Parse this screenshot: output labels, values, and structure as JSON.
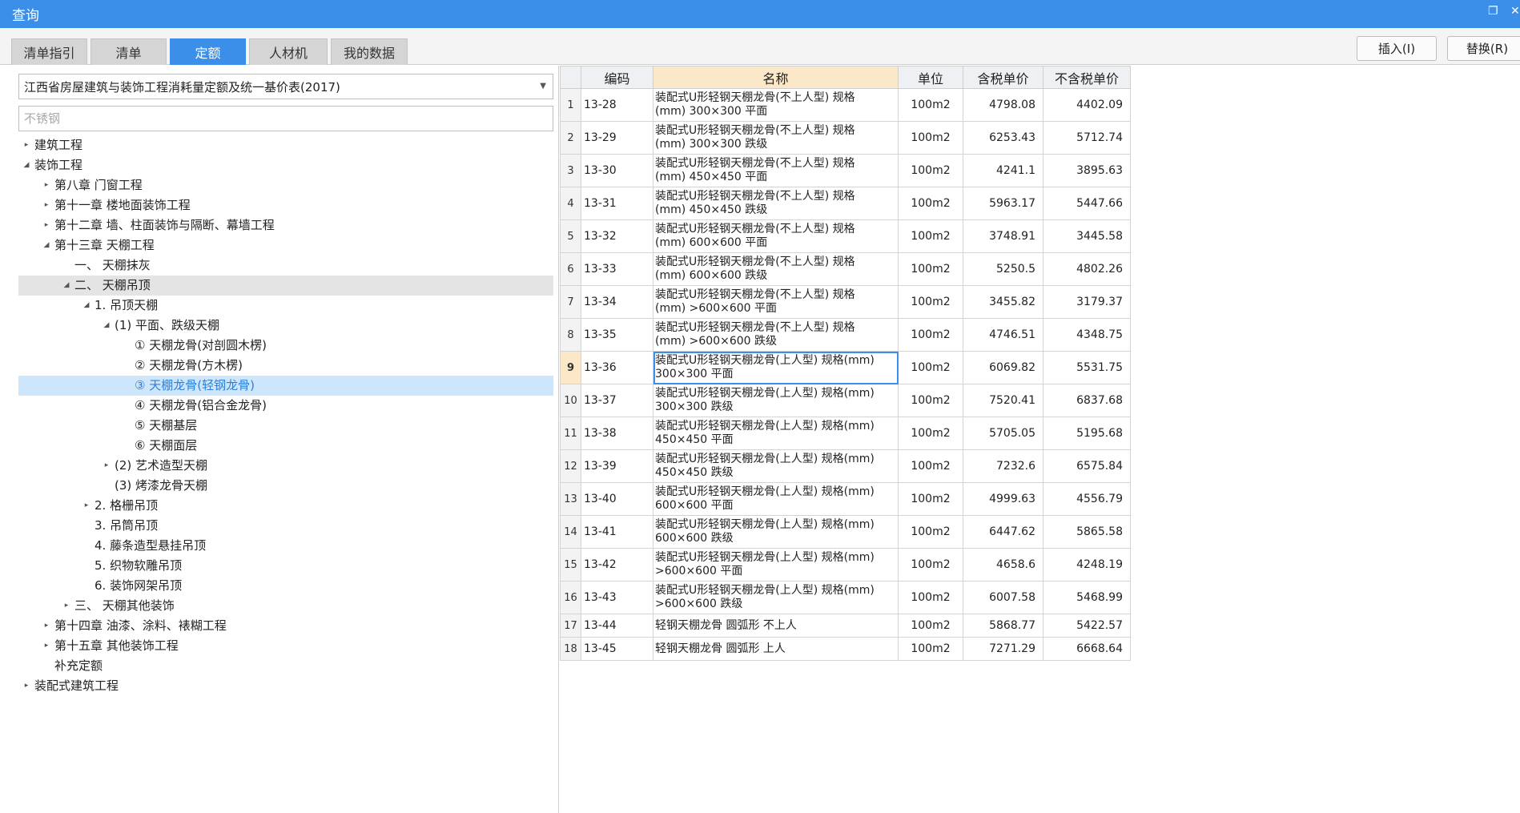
{
  "window": {
    "title": "查询",
    "restore_icon": "restore-icon",
    "close_icon": "close-icon"
  },
  "tabs": [
    {
      "label": "清单指引",
      "active": false
    },
    {
      "label": "清单",
      "active": false
    },
    {
      "label": "定额",
      "active": true
    },
    {
      "label": "人材机",
      "active": false
    },
    {
      "label": "我的数据",
      "active": false
    }
  ],
  "buttons": {
    "insert": "插入(I)",
    "replace": "替换(R)"
  },
  "library": {
    "selected": "江西省房屋建筑与装饰工程消耗量定额及统一基价表(2017)"
  },
  "search": {
    "value": "",
    "placeholder": "不锈钢"
  },
  "tree": [
    {
      "label": "建筑工程",
      "toggle": "▸"
    },
    {
      "label": "装饰工程",
      "toggle": "◢"
    },
    {
      "label": "第八章 门窗工程",
      "toggle": "▸"
    },
    {
      "label": "第十一章 楼地面装饰工程",
      "toggle": "▸"
    },
    {
      "label": "第十二章 墙、柱面装饰与隔断、幕墙工程",
      "toggle": "▸"
    },
    {
      "label": "第十三章 天棚工程",
      "toggle": "◢"
    },
    {
      "label": "一、 天棚抹灰",
      "toggle": ""
    },
    {
      "label": "二、 天棚吊顶",
      "toggle": "◢"
    },
    {
      "label": "1. 吊顶天棚",
      "toggle": "◢"
    },
    {
      "label": "(1) 平面、跌级天棚",
      "toggle": "◢"
    },
    {
      "label": "① 天棚龙骨(对剖圆木楞)",
      "toggle": ""
    },
    {
      "label": "② 天棚龙骨(方木楞)",
      "toggle": ""
    },
    {
      "label": "③ 天棚龙骨(轻钢龙骨)",
      "toggle": ""
    },
    {
      "label": "④ 天棚龙骨(铝合金龙骨)",
      "toggle": ""
    },
    {
      "label": "⑤ 天棚基层",
      "toggle": ""
    },
    {
      "label": "⑥ 天棚面层",
      "toggle": ""
    },
    {
      "label": "(2) 艺术造型天棚",
      "toggle": "▸"
    },
    {
      "label": "(3) 烤漆龙骨天棚",
      "toggle": ""
    },
    {
      "label": "2. 格栅吊顶",
      "toggle": "▸"
    },
    {
      "label": "3. 吊筒吊顶",
      "toggle": ""
    },
    {
      "label": "4. 藤条造型悬挂吊顶",
      "toggle": ""
    },
    {
      "label": "5. 织物软雕吊顶",
      "toggle": ""
    },
    {
      "label": "6. 装饰网架吊顶",
      "toggle": ""
    },
    {
      "label": "三、 天棚其他装饰",
      "toggle": "▸"
    },
    {
      "label": "第十四章 油漆、涂料、裱糊工程",
      "toggle": "▸"
    },
    {
      "label": "第十五章 其他装饰工程",
      "toggle": "▸"
    },
    {
      "label": "补充定额",
      "toggle": ""
    },
    {
      "label": "装配式建筑工程",
      "toggle": "▸"
    }
  ],
  "grid": {
    "headers": [
      "",
      "编码",
      "名称",
      "单位",
      "含税单价",
      "不含税单价"
    ],
    "rows": [
      {
        "idx": "1",
        "code": "13-28",
        "name1": "装配式U形轻钢天棚龙骨(不上人型) 规格",
        "name2": "(mm) 300×300 平面",
        "unit": "100m2",
        "tax": "4798.08",
        "notax": "4402.09"
      },
      {
        "idx": "2",
        "code": "13-29",
        "name1": "装配式U形轻钢天棚龙骨(不上人型) 规格",
        "name2": "(mm) 300×300 跌级",
        "unit": "100m2",
        "tax": "6253.43",
        "notax": "5712.74"
      },
      {
        "idx": "3",
        "code": "13-30",
        "name1": "装配式U形轻钢天棚龙骨(不上人型) 规格",
        "name2": "(mm) 450×450 平面",
        "unit": "100m2",
        "tax": "4241.1",
        "notax": "3895.63"
      },
      {
        "idx": "4",
        "code": "13-31",
        "name1": "装配式U形轻钢天棚龙骨(不上人型) 规格",
        "name2": "(mm) 450×450 跌级",
        "unit": "100m2",
        "tax": "5963.17",
        "notax": "5447.66"
      },
      {
        "idx": "5",
        "code": "13-32",
        "name1": "装配式U形轻钢天棚龙骨(不上人型) 规格",
        "name2": "(mm) 600×600 平面",
        "unit": "100m2",
        "tax": "3748.91",
        "notax": "3445.58"
      },
      {
        "idx": "6",
        "code": "13-33",
        "name1": "装配式U形轻钢天棚龙骨(不上人型) 规格",
        "name2": "(mm) 600×600 跌级",
        "unit": "100m2",
        "tax": "5250.5",
        "notax": "4802.26"
      },
      {
        "idx": "7",
        "code": "13-34",
        "name1": "装配式U形轻钢天棚龙骨(不上人型) 规格",
        "name2": "(mm) >600×600 平面",
        "unit": "100m2",
        "tax": "3455.82",
        "notax": "3179.37"
      },
      {
        "idx": "8",
        "code": "13-35",
        "name1": "装配式U形轻钢天棚龙骨(不上人型) 规格",
        "name2": "(mm) >600×600 跌级",
        "unit": "100m2",
        "tax": "4746.51",
        "notax": "4348.75"
      },
      {
        "idx": "9",
        "code": "13-36",
        "name1": "装配式U形轻钢天棚龙骨(上人型) 规格(mm)",
        "name2": "300×300 平面",
        "unit": "100m2",
        "tax": "6069.82",
        "notax": "5531.75"
      },
      {
        "idx": "10",
        "code": "13-37",
        "name1": "装配式U形轻钢天棚龙骨(上人型) 规格(mm)",
        "name2": "300×300 跌级",
        "unit": "100m2",
        "tax": "7520.41",
        "notax": "6837.68"
      },
      {
        "idx": "11",
        "code": "13-38",
        "name1": "装配式U形轻钢天棚龙骨(上人型) 规格(mm)",
        "name2": "450×450 平面",
        "unit": "100m2",
        "tax": "5705.05",
        "notax": "5195.68"
      },
      {
        "idx": "12",
        "code": "13-39",
        "name1": "装配式U形轻钢天棚龙骨(上人型) 规格(mm)",
        "name2": "450×450 跌级",
        "unit": "100m2",
        "tax": "7232.6",
        "notax": "6575.84"
      },
      {
        "idx": "13",
        "code": "13-40",
        "name1": "装配式U形轻钢天棚龙骨(上人型) 规格(mm)",
        "name2": "600×600 平面",
        "unit": "100m2",
        "tax": "4999.63",
        "notax": "4556.79"
      },
      {
        "idx": "14",
        "code": "13-41",
        "name1": "装配式U形轻钢天棚龙骨(上人型) 规格(mm)",
        "name2": "600×600 跌级",
        "unit": "100m2",
        "tax": "6447.62",
        "notax": "5865.58"
      },
      {
        "idx": "15",
        "code": "13-42",
        "name1": "装配式U形轻钢天棚龙骨(上人型) 规格(mm)",
        "name2": ">600×600 平面",
        "unit": "100m2",
        "tax": "4658.6",
        "notax": "4248.19"
      },
      {
        "idx": "16",
        "code": "13-43",
        "name1": "装配式U形轻钢天棚龙骨(上人型) 规格(mm)",
        "name2": ">600×600 跌级",
        "unit": "100m2",
        "tax": "6007.58",
        "notax": "5468.99"
      },
      {
        "idx": "17",
        "code": "13-44",
        "name1": "轻钢天棚龙骨 圆弧形 不上人",
        "name2": "",
        "unit": "100m2",
        "tax": "5868.77",
        "notax": "5422.57"
      },
      {
        "idx": "18",
        "code": "13-45",
        "name1": "轻钢天棚龙骨 圆弧形 上人",
        "name2": "",
        "unit": "100m2",
        "tax": "7271.29",
        "notax": "6668.64"
      }
    ]
  }
}
